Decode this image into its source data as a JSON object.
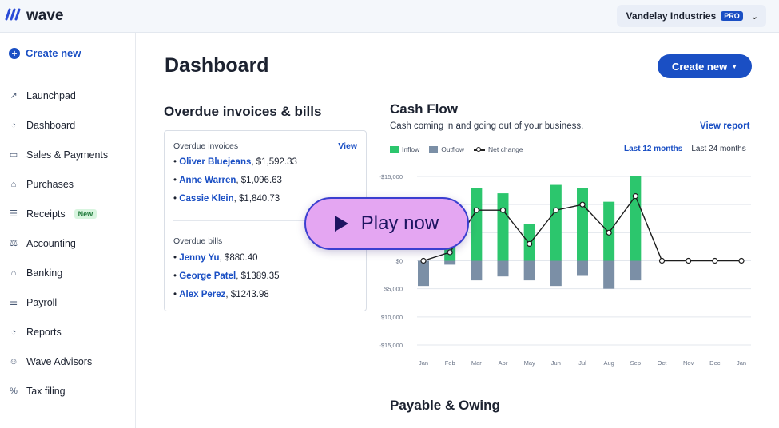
{
  "topbar": {
    "logo_mark": "͡͡",
    "logo_text": "wave",
    "business": "Vandelay Industries",
    "pro_badge": "PRO"
  },
  "sidebar": {
    "create_label": "Create new",
    "items": [
      {
        "label": "Launchpad",
        "icon": "rocket-icon",
        "glyph": "↗"
      },
      {
        "label": "Dashboard",
        "icon": "gauge-icon",
        "glyph": "◔"
      },
      {
        "label": "Sales & Payments",
        "icon": "card-icon",
        "glyph": "▭"
      },
      {
        "label": "Purchases",
        "icon": "cart-icon",
        "glyph": "⌂"
      },
      {
        "label": "Receipts",
        "icon": "receipt-icon",
        "glyph": "☰",
        "badge": "New"
      },
      {
        "label": "Accounting",
        "icon": "scale-icon",
        "glyph": "⚖"
      },
      {
        "label": "Banking",
        "icon": "bank-icon",
        "glyph": "⌂"
      },
      {
        "label": "Payroll",
        "icon": "payroll-icon",
        "glyph": "☰"
      },
      {
        "label": "Reports",
        "icon": "pie-chart-icon",
        "glyph": "◔"
      },
      {
        "label": "Wave Advisors",
        "icon": "people-icon",
        "glyph": "☺"
      },
      {
        "label": "Tax filing",
        "icon": "percent-icon",
        "glyph": "%"
      }
    ]
  },
  "main": {
    "title": "Dashboard",
    "create_button": "Create new",
    "overdue": {
      "title": "Overdue invoices & bills",
      "invoices_label": "Overdue invoices",
      "view": "View",
      "invoices": [
        {
          "name": "Oliver Bluejeans",
          "amount": ", $1,592.33"
        },
        {
          "name": "Anne Warren",
          "amount": ", $1,096.63"
        },
        {
          "name": "Cassie Klein",
          "amount": ", $1,840.73"
        }
      ],
      "bills_label": "Overdue bills",
      "bills": [
        {
          "name": "Jenny Yu",
          "amount": ", $880.40"
        },
        {
          "name": "George Patel",
          "amount": ", $1389.35"
        },
        {
          "name": "Alex Perez",
          "amount": ", $1243.98"
        }
      ]
    },
    "cashflow": {
      "title": "Cash Flow",
      "subtitle": "Cash coming in and going out of your business.",
      "view_report": "View report",
      "legend": {
        "inflow": "Inflow",
        "outflow": "Outflow",
        "net": "Net change"
      },
      "range_active": "Last 12 months",
      "range_other": "Last 24 months"
    },
    "payable_title": "Payable & Owing"
  },
  "overlay": {
    "play_label": "Play now"
  },
  "colors": {
    "accent": "#1a4fc4",
    "inflow": "#2cc66d",
    "outflow": "#7b8fa6",
    "play_bg": "#e4a6f2"
  },
  "chart_data": {
    "type": "bar",
    "categories": [
      "Jan",
      "Feb",
      "Mar",
      "Apr",
      "May",
      "Jun",
      "Jul",
      "Aug",
      "Sep",
      "Oct",
      "Nov",
      "Dec",
      "Jan"
    ],
    "y_tick_labels": [
      "-$15,000",
      "",
      "",
      "$0",
      "$5,000",
      "$10,000",
      "-$15,000"
    ],
    "series": [
      {
        "name": "Inflow",
        "values": [
          0,
          6000,
          13000,
          12000,
          6500,
          13500,
          13000,
          10500,
          15000,
          0,
          0,
          0,
          0
        ]
      },
      {
        "name": "Outflow",
        "values": [
          -4500,
          -700,
          -3500,
          -2800,
          -3500,
          -4500,
          -2700,
          -5000,
          -3500,
          0,
          0,
          0,
          0
        ]
      },
      {
        "name": "Net change",
        "values": [
          0,
          1500,
          9000,
          9000,
          3000,
          9000,
          10000,
          5000,
          11500,
          0,
          0,
          0,
          0
        ]
      }
    ],
    "ylim": [
      -15000,
      15000
    ]
  }
}
